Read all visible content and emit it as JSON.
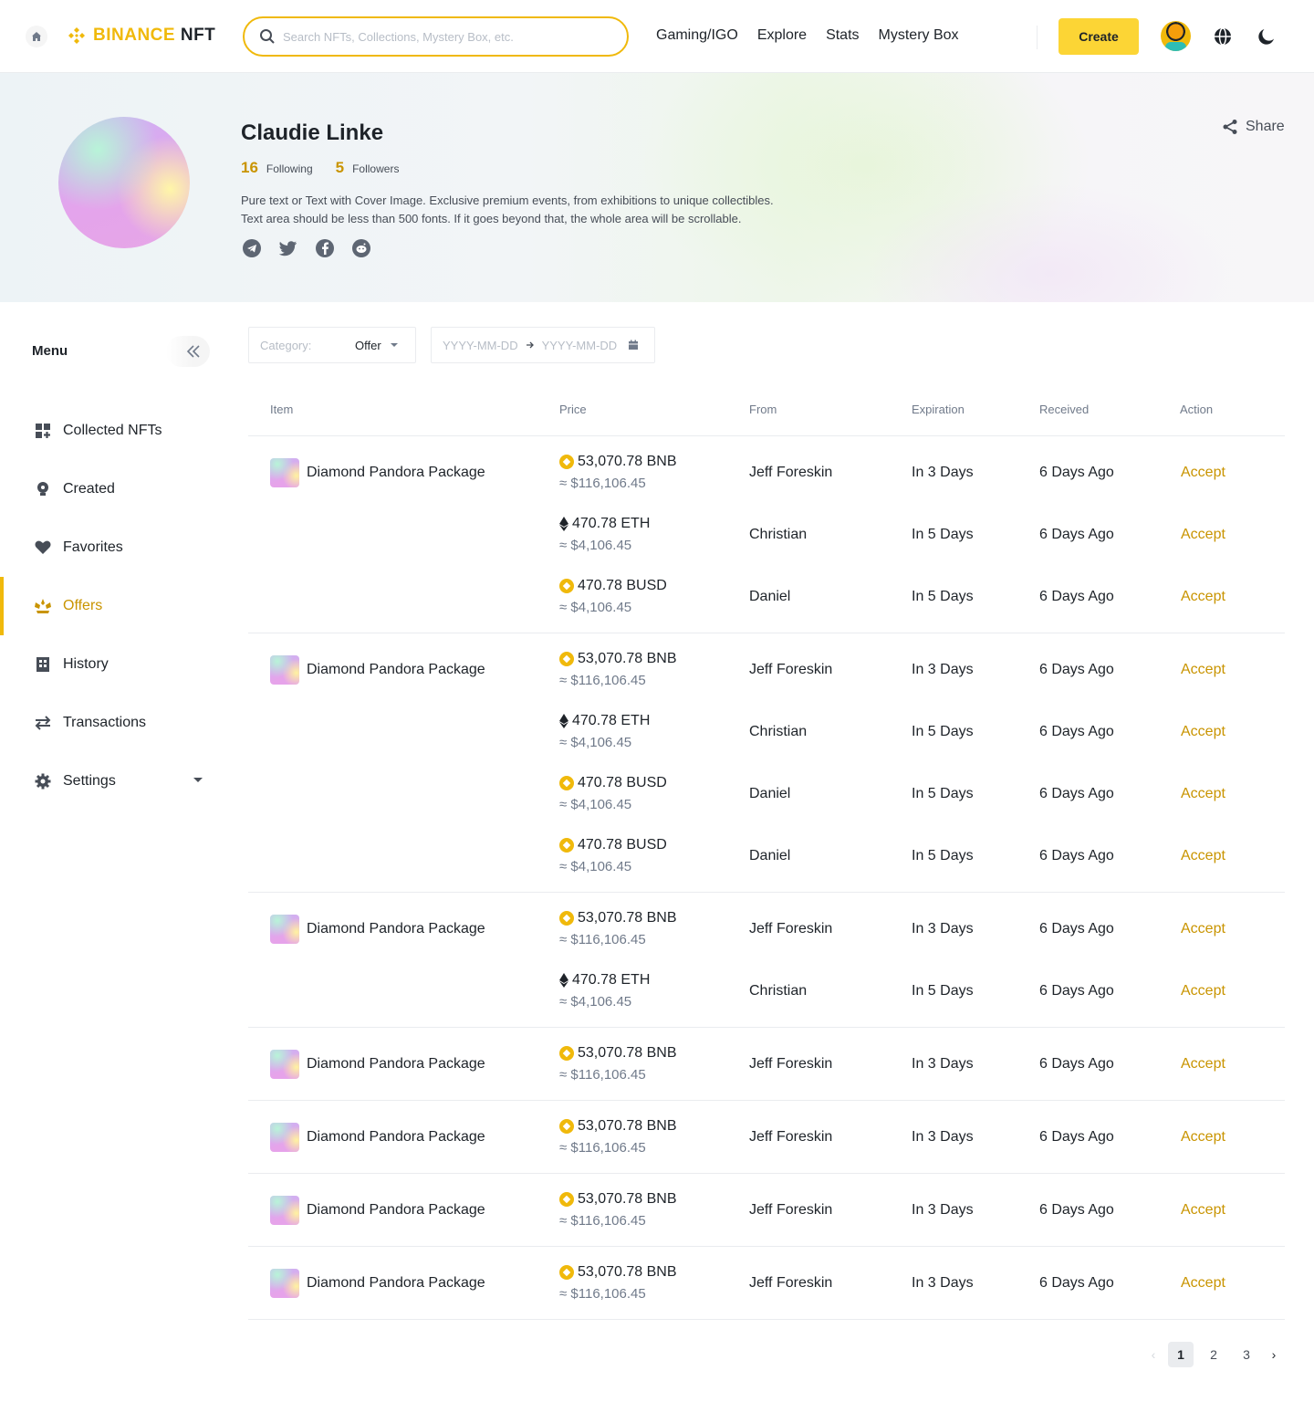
{
  "header": {
    "logo_text": "BINANCE",
    "logo_suffix": "NFT",
    "search_placeholder": "Search NFTs, Collections, Mystery Box, etc.",
    "nav": [
      "Gaming/IGO",
      "Explore",
      "Stats",
      "Mystery Box"
    ],
    "create_label": "Create"
  },
  "profile": {
    "name": "Claudie Linke",
    "following_count": "16",
    "following_label": "Following",
    "followers_count": "5",
    "followers_label": "Followers",
    "bio_line1": "Pure text or Text with Cover Image. Exclusive premium events, from exhibitions to unique collectibles.",
    "bio_line2": "Text area should be less than 500 fonts. If it goes beyond that, the whole area will be scrollable.",
    "socials": [
      "telegram-icon",
      "twitter-icon",
      "facebook-icon",
      "reddit-icon"
    ],
    "share_label": "Share"
  },
  "sidebar": {
    "title": "Menu",
    "items": [
      {
        "label": "Collected NFTs",
        "icon": "grid-icon",
        "active": false
      },
      {
        "label": "Created",
        "icon": "bulb-icon",
        "active": false
      },
      {
        "label": "Favorites",
        "icon": "heart-icon",
        "active": false
      },
      {
        "label": "Offers",
        "icon": "offer-icon",
        "active": true
      },
      {
        "label": "History",
        "icon": "history-icon",
        "active": false
      },
      {
        "label": "Transactions",
        "icon": "transfer-icon",
        "active": false
      },
      {
        "label": "Settings",
        "icon": "gear-icon",
        "active": false
      }
    ]
  },
  "filters": {
    "category_label": "Category:",
    "category_value": "Offer",
    "date_start_placeholder": "YYYY-MM-DD",
    "date_end_placeholder": "YYYY-MM-DD"
  },
  "table": {
    "headers": [
      "Item",
      "Price",
      "From",
      "Expiration",
      "Received",
      "Action"
    ],
    "groups": [
      {
        "item": "Diamond Pandora Package",
        "rows": [
          {
            "coin": "BNB",
            "amount": "53,070.78 BNB",
            "usd": "≈ $116,106.45",
            "from": "Jeff Foreskin",
            "expiration": "In 3 Days",
            "received": "6 Days Ago",
            "action": "Accept"
          },
          {
            "coin": "ETH",
            "amount": "470.78 ETH",
            "usd": "≈ $4,106.45",
            "from": "Christian",
            "expiration": "In 5 Days",
            "received": "6 Days Ago",
            "action": "Accept"
          },
          {
            "coin": "BUSD",
            "amount": "470.78 BUSD",
            "usd": "≈ $4,106.45",
            "from": "Daniel",
            "expiration": "In 5 Days",
            "received": "6 Days Ago",
            "action": "Accept"
          }
        ]
      },
      {
        "item": "Diamond Pandora Package",
        "rows": [
          {
            "coin": "BNB",
            "amount": "53,070.78 BNB",
            "usd": "≈ $116,106.45",
            "from": "Jeff Foreskin",
            "expiration": "In 3 Days",
            "received": "6 Days Ago",
            "action": "Accept"
          },
          {
            "coin": "ETH",
            "amount": "470.78 ETH",
            "usd": "≈ $4,106.45",
            "from": "Christian",
            "expiration": "In 5 Days",
            "received": "6 Days Ago",
            "action": "Accept"
          },
          {
            "coin": "BUSD",
            "amount": "470.78 BUSD",
            "usd": "≈ $4,106.45",
            "from": "Daniel",
            "expiration": "In 5 Days",
            "received": "6 Days Ago",
            "action": "Accept"
          },
          {
            "coin": "BUSD",
            "amount": "470.78 BUSD",
            "usd": "≈ $4,106.45",
            "from": "Daniel",
            "expiration": "In 5 Days",
            "received": "6 Days Ago",
            "action": "Accept"
          }
        ]
      },
      {
        "item": "Diamond Pandora Package",
        "rows": [
          {
            "coin": "BNB",
            "amount": "53,070.78 BNB",
            "usd": "≈ $116,106.45",
            "from": "Jeff Foreskin",
            "expiration": "In 3 Days",
            "received": "6 Days Ago",
            "action": "Accept"
          },
          {
            "coin": "ETH",
            "amount": "470.78 ETH",
            "usd": "≈ $4,106.45",
            "from": "Christian",
            "expiration": "In 5 Days",
            "received": "6 Days Ago",
            "action": "Accept"
          }
        ]
      },
      {
        "item": "Diamond Pandora Package",
        "rows": [
          {
            "coin": "BNB",
            "amount": "53,070.78 BNB",
            "usd": "≈ $116,106.45",
            "from": "Jeff Foreskin",
            "expiration": "In 3 Days",
            "received": "6 Days Ago",
            "action": "Accept"
          }
        ]
      },
      {
        "item": "Diamond Pandora Package",
        "rows": [
          {
            "coin": "BNB",
            "amount": "53,070.78 BNB",
            "usd": "≈ $116,106.45",
            "from": "Jeff Foreskin",
            "expiration": "In 3 Days",
            "received": "6 Days Ago",
            "action": "Accept"
          }
        ]
      },
      {
        "item": "Diamond Pandora Package",
        "rows": [
          {
            "coin": "BNB",
            "amount": "53,070.78 BNB",
            "usd": "≈ $116,106.45",
            "from": "Jeff Foreskin",
            "expiration": "In 3 Days",
            "received": "6 Days Ago",
            "action": "Accept"
          }
        ]
      },
      {
        "item": "Diamond Pandora Package",
        "rows": [
          {
            "coin": "BNB",
            "amount": "53,070.78 BNB",
            "usd": "≈ $116,106.45",
            "from": "Jeff Foreskin",
            "expiration": "In 3 Days",
            "received": "6 Days Ago",
            "action": "Accept"
          }
        ]
      }
    ]
  },
  "pagination": {
    "pages": [
      "1",
      "2",
      "3"
    ],
    "current": "1"
  },
  "colors": {
    "accent": "#f0b90b",
    "accent_text": "#c99400",
    "primary_button": "#fcd535"
  }
}
